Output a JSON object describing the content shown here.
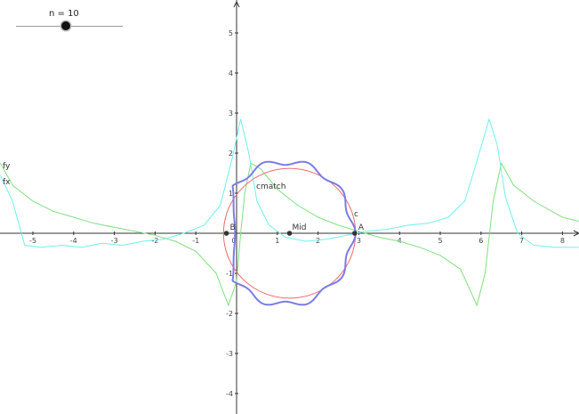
{
  "slider": {
    "label": "n = 10",
    "value": 10
  },
  "axes": {
    "x_ticks": [
      "-5",
      "-4",
      "-3",
      "-2",
      "-1",
      "0",
      "1",
      "2",
      "3",
      "4",
      "5",
      "6",
      "7",
      "8"
    ],
    "y_ticks": [
      "5",
      "4",
      "3",
      "2",
      "1",
      "-1",
      "-2",
      "-3",
      "-4"
    ]
  },
  "labels": {
    "fy": "fy",
    "fx": "fx",
    "cmatch": "cmatch",
    "c": "c",
    "mid": "Mid",
    "a": "A",
    "b": "B"
  },
  "colors": {
    "fy": "#7ee07e",
    "fx": "#6ff0f0",
    "c": "#7b7be8",
    "cmatch": "#f06a6a",
    "points": "#333333"
  },
  "chart_data": {
    "type": "line",
    "xlim": [
      -5.8,
      8.4
    ],
    "ylim": [
      -4.5,
      5.8
    ],
    "points": {
      "A": [
        2.9,
        0
      ],
      "B": [
        -0.25,
        0
      ],
      "Mid": [
        1.3,
        0
      ]
    },
    "cmatch_circle": {
      "center": [
        1.3,
        0
      ],
      "radius": 1.62
    },
    "fy": [
      [
        -5.8,
        1.75
      ],
      [
        -5.5,
        1.2
      ],
      [
        -5.0,
        0.8
      ],
      [
        -4.5,
        0.55
      ],
      [
        -4.0,
        0.4
      ],
      [
        -3.5,
        0.25
      ],
      [
        -3.0,
        0.15
      ],
      [
        -2.5,
        0.05
      ],
      [
        -2.0,
        -0.05
      ],
      [
        -1.5,
        -0.2
      ],
      [
        -1.0,
        -0.45
      ],
      [
        -0.5,
        -1.0
      ],
      [
        -0.2,
        -1.8
      ],
      [
        0.0,
        -1.2
      ],
      [
        0.1,
        0.0
      ],
      [
        0.2,
        1.0
      ],
      [
        0.35,
        1.75
      ],
      [
        0.6,
        1.6
      ],
      [
        1.0,
        1.1
      ],
      [
        1.5,
        0.7
      ],
      [
        2.0,
        0.4
      ],
      [
        2.5,
        0.2
      ],
      [
        3.0,
        0.05
      ],
      [
        3.5,
        -0.1
      ],
      [
        4.0,
        -0.2
      ],
      [
        4.5,
        -0.35
      ],
      [
        5.0,
        -0.55
      ],
      [
        5.5,
        -0.9
      ],
      [
        5.9,
        -1.8
      ],
      [
        6.1,
        -1.0
      ],
      [
        6.3,
        0.8
      ],
      [
        6.5,
        1.75
      ],
      [
        6.8,
        1.2
      ],
      [
        7.3,
        0.8
      ],
      [
        8.0,
        0.4
      ],
      [
        8.4,
        0.3
      ]
    ],
    "fx": [
      [
        -5.8,
        1.45
      ],
      [
        -5.5,
        0.8
      ],
      [
        -5.2,
        -0.3
      ],
      [
        -4.8,
        -0.35
      ],
      [
        -4.3,
        -0.3
      ],
      [
        -3.8,
        -0.35
      ],
      [
        -3.3,
        -0.25
      ],
      [
        -2.8,
        -0.3
      ],
      [
        -2.3,
        -0.2
      ],
      [
        -1.8,
        -0.15
      ],
      [
        -1.3,
        0.0
      ],
      [
        -0.8,
        0.2
      ],
      [
        -0.4,
        0.7
      ],
      [
        -0.1,
        1.9
      ],
      [
        0.1,
        2.85
      ],
      [
        0.3,
        2.0
      ],
      [
        0.5,
        0.8
      ],
      [
        0.8,
        0.2
      ],
      [
        1.2,
        -0.1
      ],
      [
        1.7,
        -0.2
      ],
      [
        2.2,
        -0.15
      ],
      [
        2.7,
        -0.05
      ],
      [
        3.2,
        0.05
      ],
      [
        3.7,
        0.1
      ],
      [
        4.2,
        0.2
      ],
      [
        4.7,
        0.25
      ],
      [
        5.2,
        0.4
      ],
      [
        5.6,
        0.8
      ],
      [
        5.9,
        1.8
      ],
      [
        6.2,
        2.85
      ],
      [
        6.4,
        2.2
      ],
      [
        6.6,
        0.9
      ],
      [
        6.9,
        0.0
      ],
      [
        7.3,
        -0.3
      ],
      [
        7.8,
        -0.35
      ],
      [
        8.4,
        -0.35
      ]
    ]
  }
}
